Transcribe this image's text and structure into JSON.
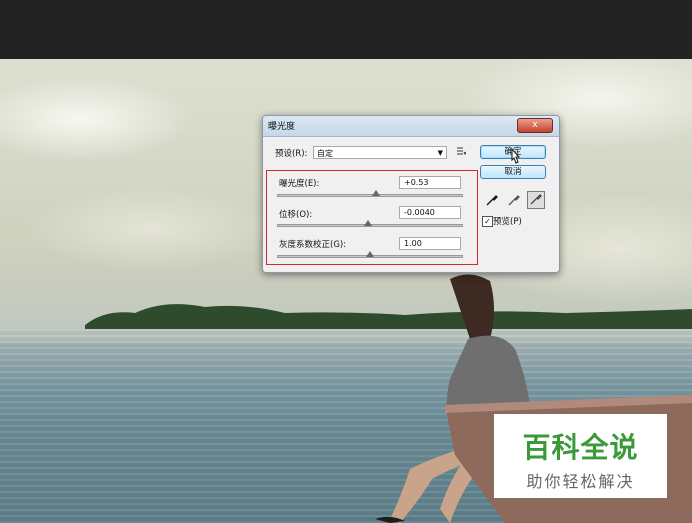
{
  "dialog": {
    "title": "曝光度",
    "close_label": "x",
    "preset_label": "预设(R):",
    "preset_value": "自定",
    "ok_label": "确定",
    "cancel_label": "取消",
    "preview_label": "预览(P)",
    "preview_checked": "✓",
    "params": [
      {
        "label": "曝光度(E):",
        "value": "+0.53",
        "slider_level": 0.53
      },
      {
        "label": "位移(O):",
        "value": "-0.0040",
        "slider_level": 0.49
      },
      {
        "label": "灰度系数校正(G):",
        "value": "1.00",
        "slider_level": 0.5
      }
    ]
  },
  "watermark": {
    "title": "百科全说",
    "subtitle": "助你轻松解决",
    "title_color": "#3a9a3a"
  },
  "icons": [
    "close-icon",
    "dropdown-arrow-icon",
    "preset-menu-icon",
    "black-eyedropper-icon",
    "gray-eyedropper-icon",
    "white-eyedropper-icon",
    "mouse-cursor-icon"
  ]
}
